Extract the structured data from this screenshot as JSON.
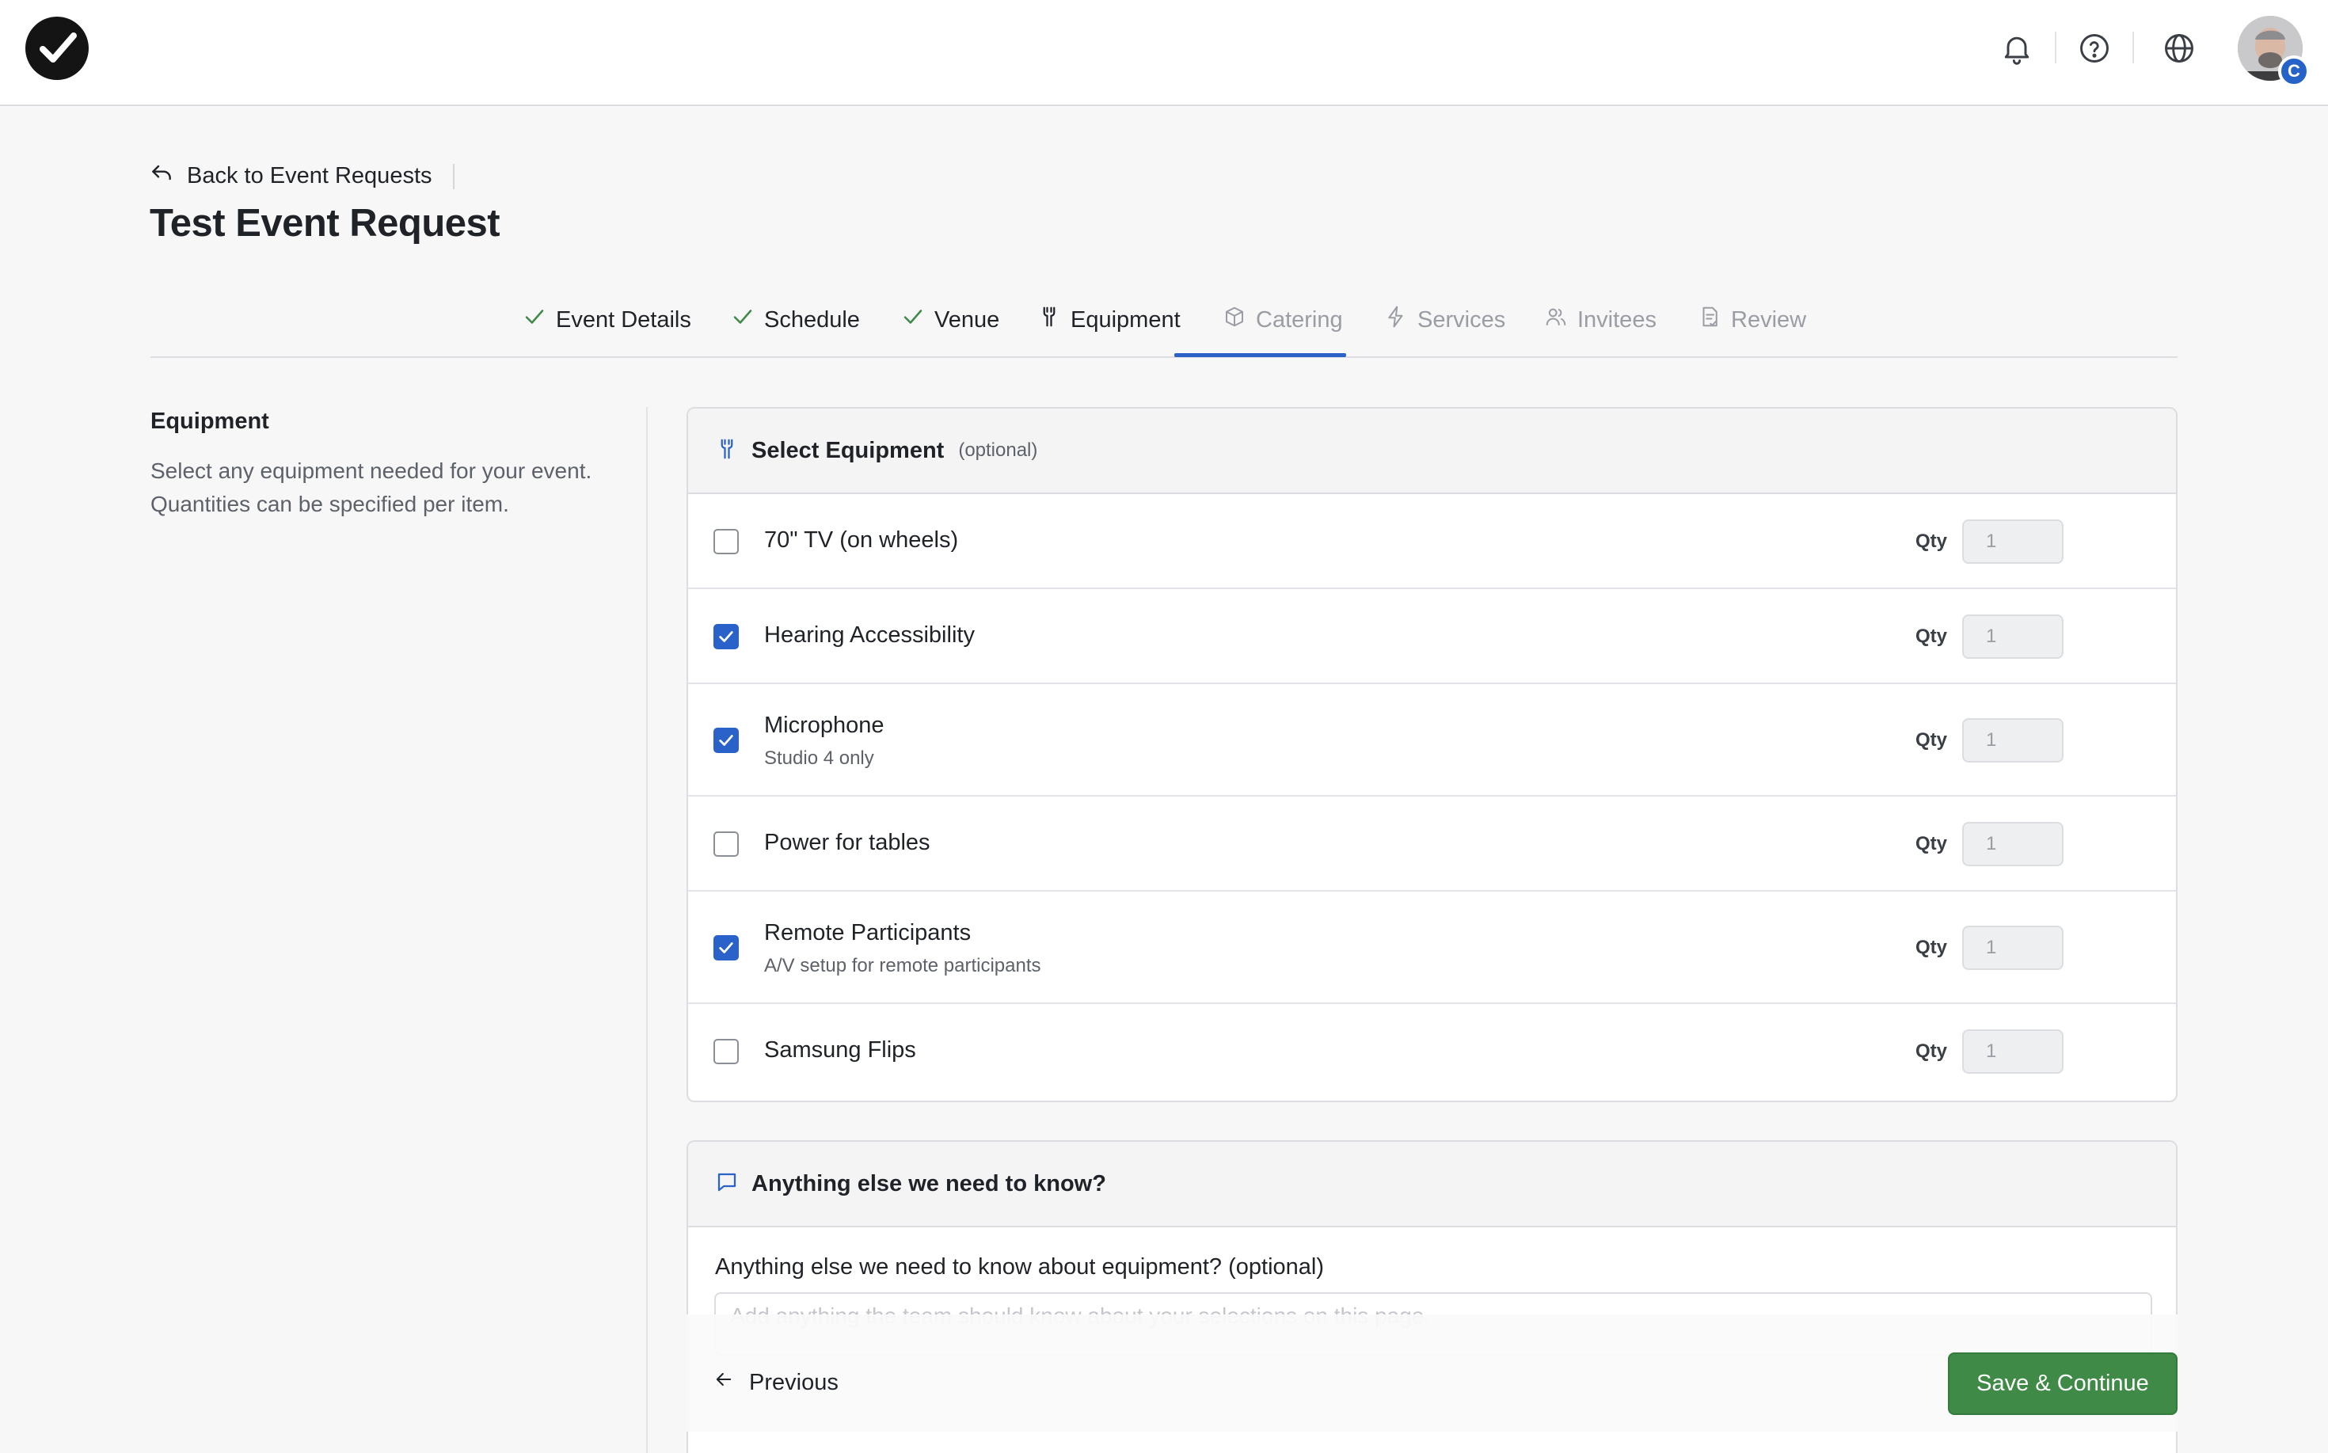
{
  "header": {
    "logo": "checkmark-logo",
    "icons": [
      "bell-icon",
      "help-circle-icon",
      "globe-icon"
    ],
    "avatar_badge": "C"
  },
  "back_link": {
    "label": "Back to Event Requests"
  },
  "page_title": "Test Event Request",
  "tabs": [
    {
      "label": "Event Details",
      "state": "done",
      "icon": "check-icon"
    },
    {
      "label": "Schedule",
      "state": "done",
      "icon": "check-icon"
    },
    {
      "label": "Venue",
      "state": "done",
      "icon": "check-icon"
    },
    {
      "label": "Equipment",
      "state": "active",
      "icon": "wrench-icon"
    },
    {
      "label": "Catering",
      "state": "todo",
      "icon": "box-icon"
    },
    {
      "label": "Services",
      "state": "todo",
      "icon": "lightning-icon"
    },
    {
      "label": "Invitees",
      "state": "todo",
      "icon": "people-icon"
    },
    {
      "label": "Review",
      "state": "todo",
      "icon": "document-icon"
    }
  ],
  "sidebar": {
    "title": "Equipment",
    "description": "Select any equipment needed for your event. Quantities can be specified per item."
  },
  "equipment_card": {
    "title": "Select Equipment",
    "optional": "(optional)",
    "qty_label": "Qty",
    "items": [
      {
        "name": "70\" TV (on wheels)",
        "subtitle": "",
        "checked": false,
        "qty": "1"
      },
      {
        "name": "Hearing Accessibility",
        "subtitle": "",
        "checked": true,
        "qty": "1"
      },
      {
        "name": "Microphone",
        "subtitle": "Studio 4 only",
        "checked": true,
        "qty": "1"
      },
      {
        "name": "Power for tables",
        "subtitle": "",
        "checked": false,
        "qty": "1"
      },
      {
        "name": "Remote Participants",
        "subtitle": "A/V setup for remote participants",
        "checked": true,
        "qty": "1"
      },
      {
        "name": "Samsung Flips",
        "subtitle": "",
        "checked": false,
        "qty": "1"
      }
    ]
  },
  "notes_card": {
    "title": "Anything else we need to know?",
    "field_label": "Anything else we need to know about equipment? (optional)",
    "placeholder": "Add anything the team should know about your selections on this page."
  },
  "footer": {
    "previous_label": "Previous",
    "save_label": "Save & Continue"
  },
  "colors": {
    "accent": "#2a62c9",
    "done_check": "#3e8a46",
    "save_button": "#3e8a46"
  }
}
